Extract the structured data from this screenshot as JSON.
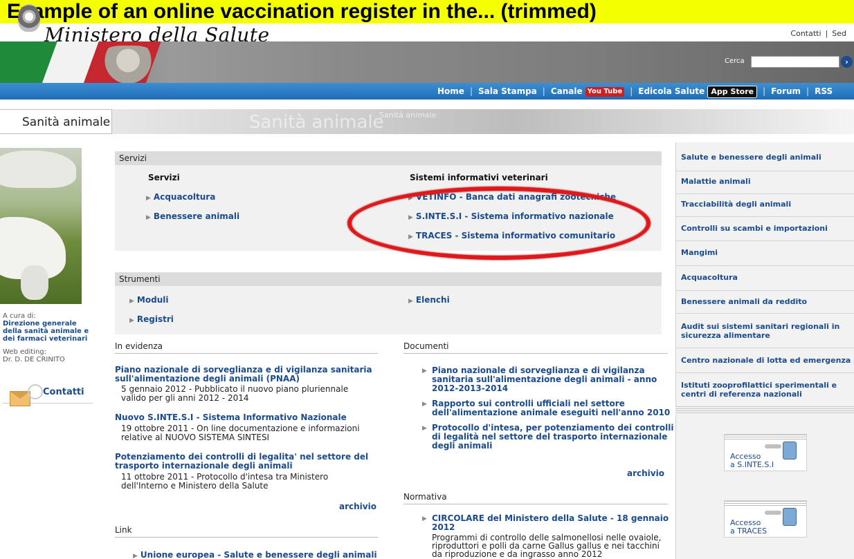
{
  "caption": "Example of an online vaccination register in the... (trimmed)",
  "header": {
    "logo_text": "Ministero della Salute",
    "top_links": [
      "Contatti",
      "|",
      "Sed"
    ]
  },
  "search": {
    "label": "Cerca",
    "value": "",
    "go": "›"
  },
  "nav": {
    "home": "Home",
    "sala_stampa": "Sala Stampa",
    "canale": "Canale",
    "youtube": "You Tube",
    "edicola": "Edicola Salute",
    "appstore": "App Store",
    "forum": "Forum",
    "rss": "RSS",
    "sep": "|"
  },
  "section": {
    "title": "Sanità animale",
    "watermark": "Sanità animale",
    "watermark_small": "Sanità animale"
  },
  "left": {
    "a_cura_di": "A cura di:",
    "direzione": [
      "Direzione generale",
      "della sanità animale e",
      "dei farmaci veterinari"
    ],
    "web_editing": "Web editing:",
    "editor": "Dr. D. DE CRINITO",
    "contatti": "Contatti"
  },
  "servizi": {
    "head": "Servizi",
    "col1_title": "Servizi",
    "col1_links": [
      "Acquacoltura",
      "Benessere animali"
    ],
    "col2_title": "Sistemi informativi veterinari",
    "col2_links": [
      "VETINFO - Banca dati anagrafi zootecniche",
      "S.INTE.S.I - Sistema informativo nazionale",
      "TRACES - Sistema informativo comunitario"
    ]
  },
  "strumenti": {
    "head": "Strumenti",
    "links": [
      "Moduli",
      "Registri",
      "Elenchi"
    ]
  },
  "evidenza": {
    "head": "In evidenza",
    "items": [
      {
        "title1": "Piano nazionale di sorveglianza e di vigilanza sanitaria",
        "title2": "sull'alimentazione degli animali (PNAA)",
        "desc1": "5 gennaio 2012 - Pubblicato il nuovo piano pluriennale",
        "desc2": "valido per gli anni 2012 - 2014"
      },
      {
        "title1": "Nuovo S.INTE.S.I - Sistema Informativo Nazionale",
        "title2": "",
        "desc1": "19 ottobre 2011 - On line documentazione e informazioni",
        "desc2": "relative al NUOVO SISTEMA SINTESI"
      },
      {
        "title1": "Potenziamento dei controlli di legalita' nel settore del",
        "title2": "trasporto internazionale degli animali",
        "desc1": "11 ottobre 2011 - Protocollo d'intesa tra Ministero",
        "desc2": "dell'Interno e Ministero della Salute"
      }
    ],
    "archivio": "archivio"
  },
  "documenti": {
    "head": "Documenti",
    "items": [
      [
        "Piano nazionale di sorveglianza e di vigilanza",
        "sanitaria sull'alimentazione degli animali - anno",
        "2012-2013-2014"
      ],
      [
        "Rapporto sui controlli ufficiali nel settore",
        "dell'alimentazione animale eseguiti nell'anno 2010"
      ],
      [
        "Protocollo d'intesa, per potenziamento dei controlli",
        "di legalità nel settore del trasporto internazionale",
        "degli animali"
      ]
    ],
    "archivio": "archivio"
  },
  "normativa": {
    "head": "Normativa",
    "title1": "CIRCOLARE del Ministero della Salute - 18 gennaio",
    "title2": "2012",
    "desc1": "Programmi di controllo delle salmonellosi nelle ovaiole,",
    "desc2": "riproduttori e polli da carne Gallus gallus e nei tacchini",
    "desc3": "da riproduzione e da ingrasso anno 2012"
  },
  "link": {
    "head": "Link",
    "item": "Unione europea - Salute e benessere degli animali"
  },
  "right": {
    "items": [
      "Salute e benessere degli animali",
      "Malattie animali",
      "Tracciabilità degli animali",
      "Controlli su scambi e importazioni",
      "Mangimi",
      "Acquacoltura",
      "Benessere animali da reddito",
      "Audit sui sistemi sanitari regionali in",
      "sicurezza alimentare",
      "Centro nazionale di lotta ed emergenza",
      "Istituti zooprofilattici sperimentali e",
      "centri di referenza nazionali"
    ],
    "access1": [
      "Accesso",
      "a S.INTE.S.I"
    ],
    "access2": [
      "Accesso",
      "a TRACES"
    ]
  },
  "colors": {
    "link": "#1a4b8d",
    "nav": "#1e6cb8",
    "highlight": "#e0181b"
  }
}
